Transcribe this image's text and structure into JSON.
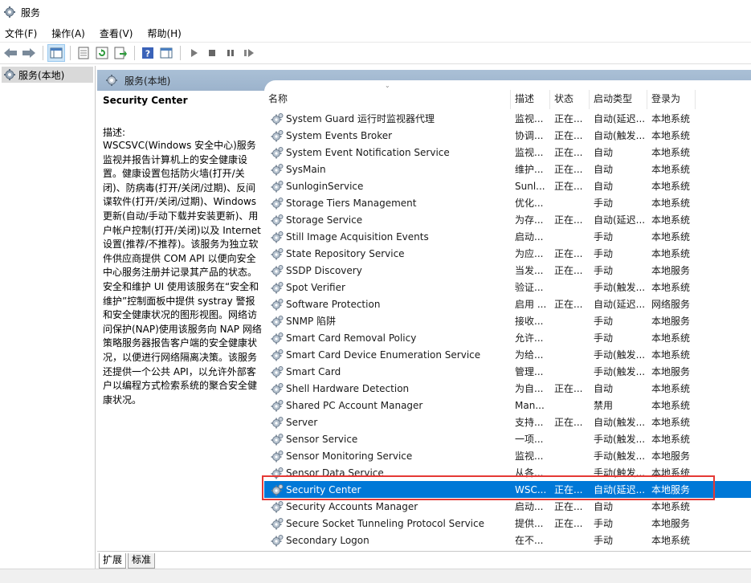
{
  "window": {
    "title": "服务"
  },
  "menu": [
    "文件(F)",
    "操作(A)",
    "查看(V)",
    "帮助(H)"
  ],
  "tree": {
    "root_label": "服务(本地)"
  },
  "panel": {
    "header": "服务(本地)"
  },
  "description": {
    "service_name": "Security Center",
    "label": "描述:",
    "text": "WSCSVC(Windows 安全中心)服务监视并报告计算机上的安全健康设置。健康设置包括防火墙(打开/关闭)、防病毒(打开/关闭/过期)、反间谍软件(打开/关闭/过期)、Windows 更新(自动/手动下载并安装更新)、用户帐户控制(打开/关闭)以及 Internet 设置(推荐/不推荐)。该服务为独立软件供应商提供 COM API 以便向安全中心服务注册并记录其产品的状态。安全和维护 UI 使用该服务在“安全和维护”控制面板中提供 systray 警报和安全健康状况的图形视图。网络访问保护(NAP)使用该服务向 NAP 网络策略服务器报告客户端的安全健康状况，以便进行网络隔离决策。该服务还提供一个公共 API，以允许外部客户以编程方式检索系统的聚合安全健康状况。"
  },
  "columns": [
    "名称",
    "描述",
    "状态",
    "启动类型",
    "登录为"
  ],
  "services": [
    {
      "name": "System Guard 运行时监视器代理",
      "desc": "监视...",
      "status": "正在...",
      "startup": "自动(延迟...",
      "logon": "本地系统"
    },
    {
      "name": "System Events Broker",
      "desc": "协调...",
      "status": "正在...",
      "startup": "自动(触发...",
      "logon": "本地系统"
    },
    {
      "name": "System Event Notification Service",
      "desc": "监视...",
      "status": "正在...",
      "startup": "自动",
      "logon": "本地系统"
    },
    {
      "name": "SysMain",
      "desc": "维护...",
      "status": "正在...",
      "startup": "自动",
      "logon": "本地系统"
    },
    {
      "name": "SunloginService",
      "desc": "Sunl...",
      "status": "正在...",
      "startup": "自动",
      "logon": "本地系统"
    },
    {
      "name": "Storage Tiers Management",
      "desc": "优化...",
      "status": "",
      "startup": "手动",
      "logon": "本地系统"
    },
    {
      "name": "Storage Service",
      "desc": "为存...",
      "status": "正在...",
      "startup": "自动(延迟...",
      "logon": "本地系统"
    },
    {
      "name": "Still Image Acquisition Events",
      "desc": "启动...",
      "status": "",
      "startup": "手动",
      "logon": "本地系统"
    },
    {
      "name": "State Repository Service",
      "desc": "为应...",
      "status": "正在...",
      "startup": "手动",
      "logon": "本地系统"
    },
    {
      "name": "SSDP Discovery",
      "desc": "当发...",
      "status": "正在...",
      "startup": "手动",
      "logon": "本地服务"
    },
    {
      "name": "Spot Verifier",
      "desc": "验证...",
      "status": "",
      "startup": "手动(触发...",
      "logon": "本地系统"
    },
    {
      "name": "Software Protection",
      "desc": "启用 ...",
      "status": "正在...",
      "startup": "自动(延迟...",
      "logon": "网络服务"
    },
    {
      "name": "SNMP 陷阱",
      "desc": "接收...",
      "status": "",
      "startup": "手动",
      "logon": "本地服务"
    },
    {
      "name": "Smart Card Removal Policy",
      "desc": "允许...",
      "status": "",
      "startup": "手动",
      "logon": "本地系统"
    },
    {
      "name": "Smart Card Device Enumeration Service",
      "desc": "为给...",
      "status": "",
      "startup": "手动(触发...",
      "logon": "本地系统"
    },
    {
      "name": "Smart Card",
      "desc": "管理...",
      "status": "",
      "startup": "手动(触发...",
      "logon": "本地服务"
    },
    {
      "name": "Shell Hardware Detection",
      "desc": "为自...",
      "status": "正在...",
      "startup": "自动",
      "logon": "本地系统"
    },
    {
      "name": "Shared PC Account Manager",
      "desc": "Man...",
      "status": "",
      "startup": "禁用",
      "logon": "本地系统"
    },
    {
      "name": "Server",
      "desc": "支持...",
      "status": "正在...",
      "startup": "自动(触发...",
      "logon": "本地系统"
    },
    {
      "name": "Sensor Service",
      "desc": "一项...",
      "status": "",
      "startup": "手动(触发...",
      "logon": "本地系统"
    },
    {
      "name": "Sensor Monitoring Service",
      "desc": "监视...",
      "status": "",
      "startup": "手动(触发...",
      "logon": "本地服务"
    },
    {
      "name": "Sensor Data Service",
      "desc": "从各...",
      "status": "",
      "startup": "手动(触发...",
      "logon": "本地系统"
    },
    {
      "name": "Security Center",
      "desc": "WSC...",
      "status": "正在...",
      "startup": "自动(延迟...",
      "logon": "本地服务",
      "selected": true
    },
    {
      "name": "Security Accounts Manager",
      "desc": "启动...",
      "status": "正在...",
      "startup": "自动",
      "logon": "本地系统"
    },
    {
      "name": "Secure Socket Tunneling Protocol Service",
      "desc": "提供...",
      "status": "正在...",
      "startup": "手动",
      "logon": "本地服务"
    },
    {
      "name": "Secondary Logon",
      "desc": "在不...",
      "status": "",
      "startup": "手动",
      "logon": "本地系统"
    }
  ],
  "tabs": [
    "扩展",
    "标准"
  ],
  "colors": {
    "selection": "#0078d7",
    "panel_header": "#9cb3cc",
    "highlight_box": "#e53935"
  }
}
